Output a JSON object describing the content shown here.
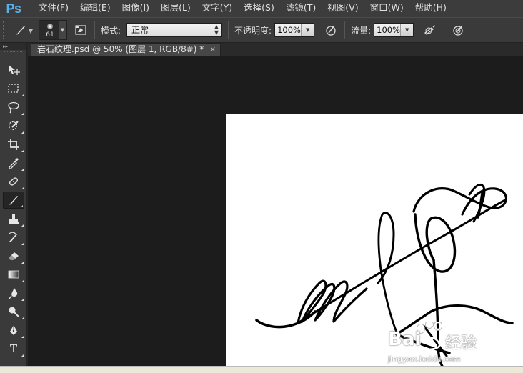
{
  "app": {
    "logo": "Ps"
  },
  "menu": [
    "文件(F)",
    "编辑(E)",
    "图像(I)",
    "图层(L)",
    "文字(Y)",
    "选择(S)",
    "滤镜(T)",
    "视图(V)",
    "窗口(W)",
    "帮助(H)"
  ],
  "options": {
    "brush_size": "61",
    "mode_label": "模式:",
    "mode_value": "正常",
    "opacity_label": "不透明度:",
    "opacity_value": "100%",
    "flow_label": "流量:",
    "flow_value": "100%"
  },
  "document": {
    "tab_title": "岩石纹理.psd @ 50% (图层 1, RGB/8#) *",
    "close_glyph": "×"
  },
  "watermark": {
    "brand": "Bai",
    "brand2": "经验",
    "url": "jingyan.baidu.com"
  },
  "tools": [
    "move-tool",
    "marquee-tool",
    "lasso-tool",
    "quick-selection-tool",
    "crop-tool",
    "eyedropper-tool",
    "healing-brush-tool",
    "brush-tool",
    "clone-stamp-tool",
    "history-brush-tool",
    "eraser-tool",
    "gradient-tool",
    "blur-tool",
    "dodge-tool",
    "pen-tool",
    "type-tool"
  ],
  "type_tool_glyph": "T",
  "colors": {
    "ps_blue": "#5ab0e8",
    "canvas_bg": "#1c1c1c",
    "document_bg": "#ffffff",
    "ink": "#000000"
  }
}
